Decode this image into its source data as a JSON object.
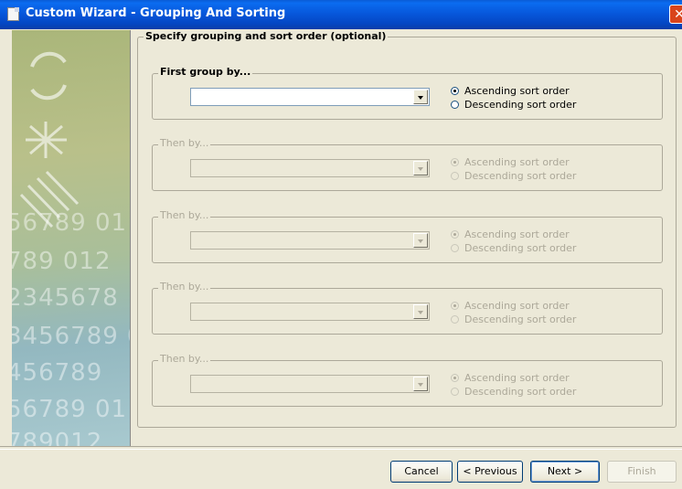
{
  "window": {
    "title": "Custom Wizard - Grouping And Sorting",
    "close_glyph": "✕"
  },
  "side_panel": {
    "decor_numbers": [
      "56789 01",
      "789 012",
      "2345678",
      "3456789 0",
      "456789",
      "56789 01",
      "789012"
    ]
  },
  "main": {
    "section_title": "Specify grouping and sort order (optional)",
    "groups": [
      {
        "legend": "First group by...",
        "value": "",
        "ascending_label": "Ascending sort order",
        "descending_label": "Descending sort order",
        "selected": "ascending",
        "enabled": true
      },
      {
        "legend": "Then by...",
        "value": "",
        "ascending_label": "Ascending sort order",
        "descending_label": "Descending sort order",
        "selected": "ascending",
        "enabled": false
      },
      {
        "legend": "Then by...",
        "value": "",
        "ascending_label": "Ascending sort order",
        "descending_label": "Descending sort order",
        "selected": "ascending",
        "enabled": false
      },
      {
        "legend": "Then by...",
        "value": "",
        "ascending_label": "Ascending sort order",
        "descending_label": "Descending sort order",
        "selected": "ascending",
        "enabled": false
      },
      {
        "legend": "Then by...",
        "value": "",
        "ascending_label": "Ascending sort order",
        "descending_label": "Descending sort order",
        "selected": "ascending",
        "enabled": false
      }
    ]
  },
  "buttons": {
    "cancel": "Cancel",
    "previous": "< Previous",
    "next": "Next >",
    "finish": "Finish"
  },
  "colors": {
    "titlebar": "#0a5bd6",
    "dialog_bg": "#ece9d8",
    "disabled_text": "#aca899"
  }
}
